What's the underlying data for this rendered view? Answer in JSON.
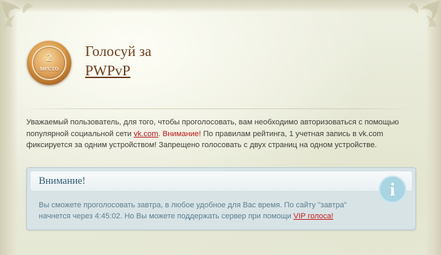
{
  "rank": {
    "number": "2",
    "label": "место"
  },
  "title": {
    "line1": "Голосуй за",
    "server_name": "PWPvP"
  },
  "notice": {
    "part1": "Уважаемый пользователь, для того, чтобы проголосовать, вам необходимо авторизоваться с помощью популярной социальной сети ",
    "vk_link": "vk.com",
    "part2": ". ",
    "warning": "Внимание!",
    "part3": " По правилам рейтинга, 1 учетная запись в vk.com фиксируется за одним устройством! Запрещено голосовать с двух страниц на одном устройстве."
  },
  "info_box": {
    "title": "Внимание!",
    "icon": "info-icon",
    "icon_glyph": "i",
    "body_part1": "Вы сможете проголосовать завтра, в любое удобное для Вас время. По сайту \"завтра\" начнется через 4:45:02. Но Вы можете поддержать сервер при помощи ",
    "vip_link": "VIP голоса!"
  },
  "colors": {
    "title_brown": "#6b3e1d",
    "warning_red": "#b8181a",
    "info_bg": "#d8e3e6",
    "info_text": "#5d7f8e"
  }
}
